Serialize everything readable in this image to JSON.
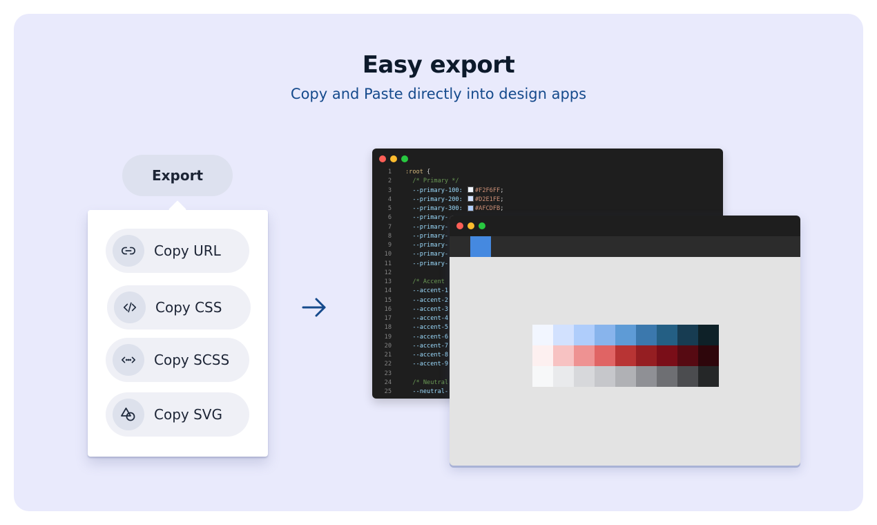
{
  "header": {
    "title": "Easy export",
    "subtitle": "Copy and Paste directly into design apps"
  },
  "export_button": {
    "label": "Export"
  },
  "menu": {
    "items": [
      {
        "label": "Copy URL",
        "icon": "link-icon"
      },
      {
        "label": "Copy CSS",
        "icon": "code-icon"
      },
      {
        "label": "Copy SCSS",
        "icon": "scss-icon"
      },
      {
        "label": "Copy SVG",
        "icon": "shapes-icon"
      }
    ]
  },
  "arrow": {
    "icon": "arrow-right-icon",
    "color": "#154a8c"
  },
  "code_editor": {
    "lines": [
      {
        "n": "1",
        "parts": [
          {
            "t": ":root ",
            "c": "selector"
          },
          {
            "t": "{",
            "c": "punct"
          }
        ]
      },
      {
        "n": "2",
        "parts": [
          {
            "t": "  /* Primary */",
            "c": "comment"
          }
        ]
      },
      {
        "n": "3",
        "parts": [
          {
            "t": "  --primary-100: ",
            "c": "var"
          },
          {
            "sw": "#F2F6FF"
          },
          {
            "t": "#F2F6FF",
            "c": "val"
          },
          {
            "t": ";",
            "c": "punct"
          }
        ]
      },
      {
        "n": "4",
        "parts": [
          {
            "t": "  --primary-200: ",
            "c": "var"
          },
          {
            "sw": "#D2E1FE"
          },
          {
            "t": "#D2E1FE",
            "c": "val"
          },
          {
            "t": ";",
            "c": "punct"
          }
        ]
      },
      {
        "n": "5",
        "parts": [
          {
            "t": "  --primary-300: ",
            "c": "var"
          },
          {
            "sw": "#AFCDFB"
          },
          {
            "t": "#AFCDFB",
            "c": "val"
          },
          {
            "t": ";",
            "c": "punct"
          }
        ]
      },
      {
        "n": "6",
        "parts": [
          {
            "t": "  --primary-",
            "c": "var"
          }
        ]
      },
      {
        "n": "7",
        "parts": [
          {
            "t": "  --primary-",
            "c": "var"
          }
        ]
      },
      {
        "n": "8",
        "parts": [
          {
            "t": "  --primary-",
            "c": "var"
          }
        ]
      },
      {
        "n": "9",
        "parts": [
          {
            "t": "  --primary-",
            "c": "var"
          }
        ]
      },
      {
        "n": "10",
        "parts": [
          {
            "t": "  --primary-",
            "c": "var"
          }
        ]
      },
      {
        "n": "11",
        "parts": [
          {
            "t": "  --primary-",
            "c": "var"
          }
        ]
      },
      {
        "n": "12",
        "parts": []
      },
      {
        "n": "13",
        "parts": [
          {
            "t": "  /* Accent",
            "c": "comment"
          }
        ]
      },
      {
        "n": "14",
        "parts": [
          {
            "t": "  --accent-1",
            "c": "var"
          }
        ]
      },
      {
        "n": "15",
        "parts": [
          {
            "t": "  --accent-2",
            "c": "var"
          }
        ]
      },
      {
        "n": "16",
        "parts": [
          {
            "t": "  --accent-3",
            "c": "var"
          }
        ]
      },
      {
        "n": "17",
        "parts": [
          {
            "t": "  --accent-4",
            "c": "var"
          }
        ]
      },
      {
        "n": "18",
        "parts": [
          {
            "t": "  --accent-5",
            "c": "var"
          }
        ]
      },
      {
        "n": "19",
        "parts": [
          {
            "t": "  --accent-6",
            "c": "var"
          }
        ]
      },
      {
        "n": "20",
        "parts": [
          {
            "t": "  --accent-7",
            "c": "var"
          }
        ]
      },
      {
        "n": "21",
        "parts": [
          {
            "t": "  --accent-8",
            "c": "var"
          }
        ]
      },
      {
        "n": "22",
        "parts": [
          {
            "t": "  --accent-9",
            "c": "var"
          }
        ]
      },
      {
        "n": "23",
        "parts": []
      },
      {
        "n": "24",
        "parts": [
          {
            "t": "  /* Neutral",
            "c": "comment"
          }
        ]
      },
      {
        "n": "25",
        "parts": [
          {
            "t": "  --neutral-",
            "c": "var"
          }
        ]
      }
    ]
  },
  "palette": {
    "rows": [
      [
        "#f2f6ff",
        "#d2e1fe",
        "#afcdfb",
        "#88b4ec",
        "#5e9bd6",
        "#3b78ad",
        "#245f84",
        "#173c52",
        "#0e2128"
      ],
      [
        "#fdf0f0",
        "#f7c2c2",
        "#ee9292",
        "#e06464",
        "#b83434",
        "#951e22",
        "#7a0e18",
        "#560a12",
        "#2e060b"
      ],
      [
        "#f7f8f9",
        "#e9eaec",
        "#d7d8db",
        "#c6c7cb",
        "#b0b1b5",
        "#8f9095",
        "#6e6f73",
        "#4b4c4f",
        "#252728"
      ]
    ]
  },
  "colors": {
    "panel_bg": "#e9eafc",
    "title": "#0d1a2b",
    "subtitle": "#154a8c",
    "traffic_red": "#fe5f57",
    "traffic_yellow": "#febc2e",
    "traffic_green": "#28c840",
    "active_tool": "#4589e0"
  }
}
